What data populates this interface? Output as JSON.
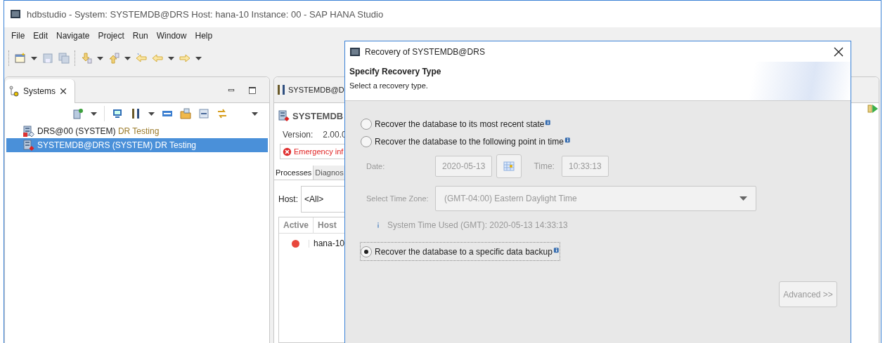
{
  "window": {
    "title": "hdbstudio - System: SYSTEMDB@DRS Host: hana-10 Instance: 00 - SAP HANA Studio"
  },
  "menu": [
    "File",
    "Edit",
    "Navigate",
    "Project",
    "Run",
    "Window",
    "Help"
  ],
  "systems_view": {
    "tab": "Systems",
    "items": [
      {
        "name": "DRS@00 (SYSTEM)",
        "description": "DR Testing",
        "selected": false
      },
      {
        "name": "SYSTEMDB@DRS (SYSTEM)",
        "description": "DR Testing",
        "selected": true
      }
    ]
  },
  "editor": {
    "tab": "SYSTEMDB@D",
    "heading": "SYSTEMDB",
    "version_label": "Version:",
    "version_value": "2.00.0",
    "error": "Emergency inf",
    "tabs": [
      {
        "label": "Processes",
        "selected": true
      },
      {
        "label": "Diagnos",
        "selected": false
      }
    ],
    "host_label": "Host:",
    "host_value": "<All>",
    "columns": [
      "Active",
      "Host"
    ],
    "rows": [
      {
        "color": "#e8473c",
        "host": "hana-10"
      }
    ]
  },
  "dialog": {
    "title": "Recovery of SYSTEMDB@DRS",
    "header": "Specify Recovery Type",
    "description": "Select a recovery type.",
    "options": [
      {
        "label": "Recover the database to its most recent state",
        "selected": false
      },
      {
        "label": "Recover the database to the following point in time",
        "selected": false
      },
      {
        "label": "Recover the database to a specific data backup",
        "selected": true
      }
    ],
    "point_in_time": {
      "disabled": true,
      "date_label": "Date:",
      "date": "2020-05-13",
      "time_label": "Time:",
      "time": "10:33:13",
      "time_zone_label": "Select Time Zone:",
      "time_zone": "(GMT-04:00) Eastern Daylight Time",
      "system_time": "System Time Used (GMT): 2020-05-13 14:33:13"
    },
    "advanced_button": {
      "label": "Advanced >>",
      "disabled": true
    }
  }
}
